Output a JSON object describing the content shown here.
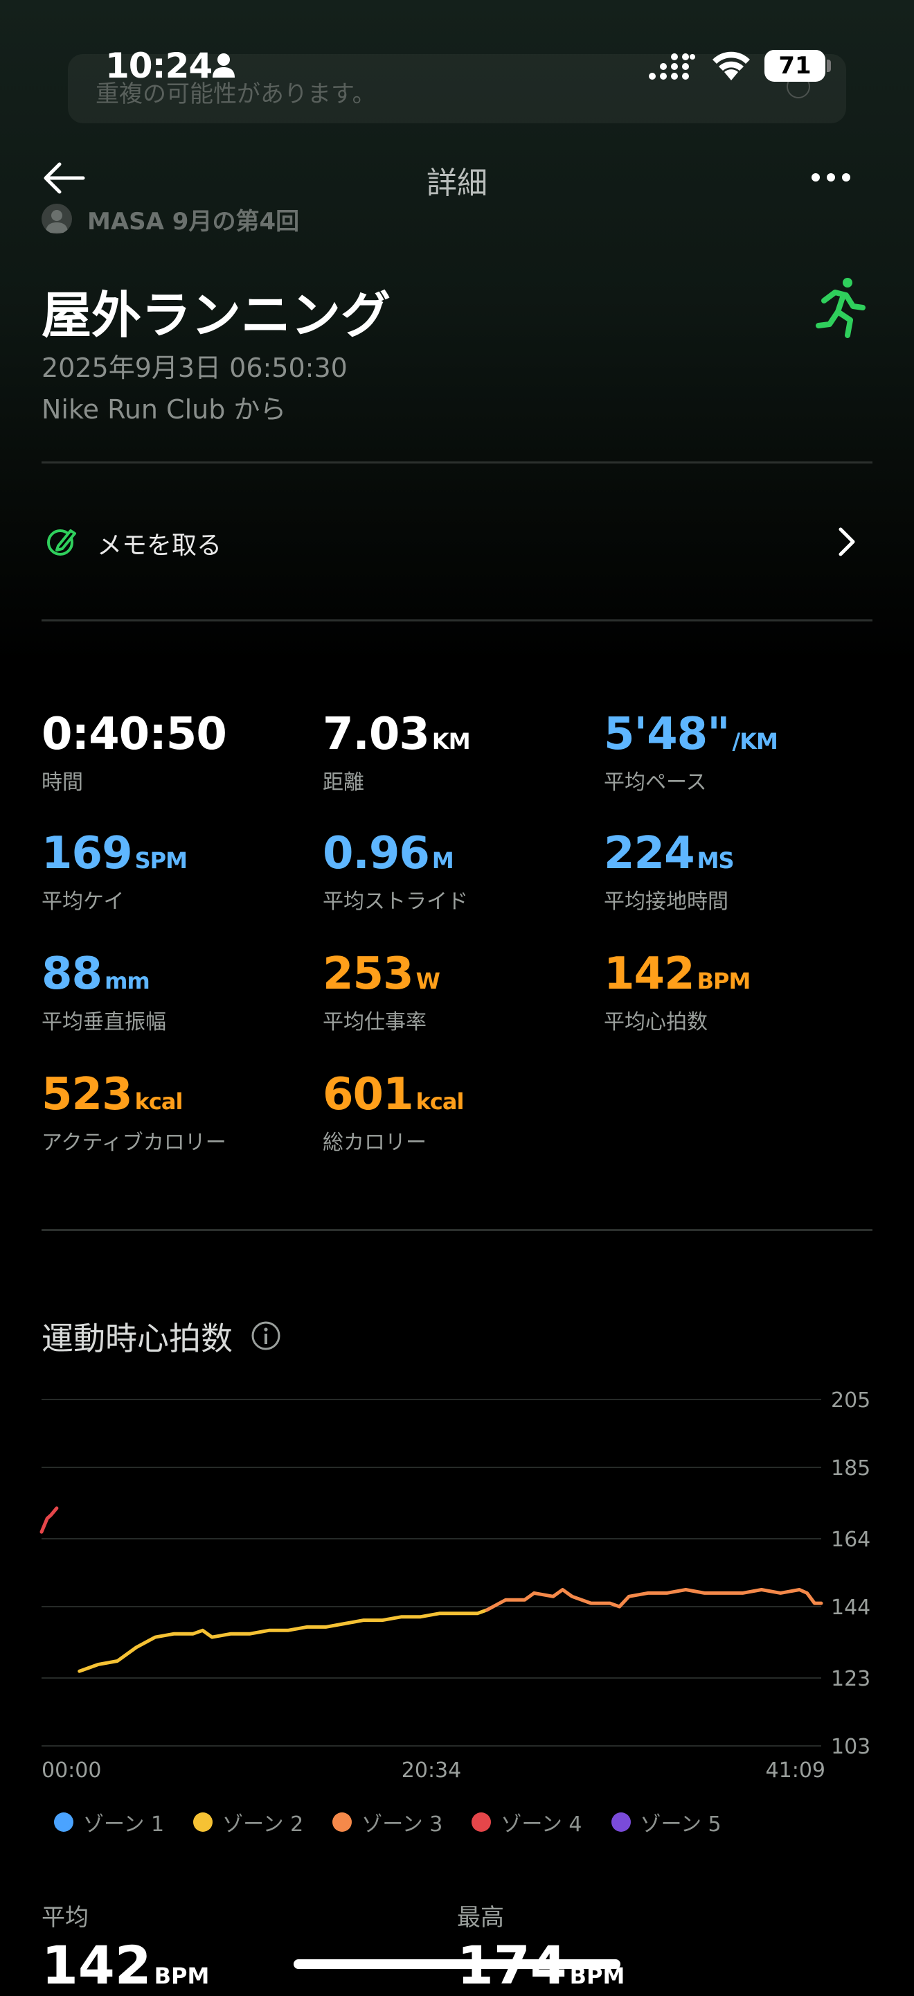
{
  "status_bar": {
    "time": "10:24",
    "battery": "71"
  },
  "notice": {
    "text": "重複の可能性があります。"
  },
  "header": {
    "title": "詳細",
    "user_line": "MASA 9月の第4回"
  },
  "activity": {
    "title": "屋外ランニング",
    "date": "2025年9月3日 06:50:30",
    "source": "Nike Run Club から",
    "icon": "running-icon",
    "accent_color": "#2fcf5c"
  },
  "memo": {
    "label": "メモを取る"
  },
  "metrics": [
    {
      "value": "0:40:50",
      "unit": "",
      "label": "時間",
      "color": "#ffffff"
    },
    {
      "value": "7.03",
      "unit": "KM",
      "label": "距離",
      "color": "#ffffff"
    },
    {
      "value": "5'48\"",
      "unit": "/KM",
      "label": "平均ペース",
      "color": "#5eb6ff"
    },
    {
      "value": "169",
      "unit": "SPM",
      "label": "平均ケイ",
      "color": "#5eb6ff"
    },
    {
      "value": "0.96",
      "unit": "M",
      "label": "平均ストライド",
      "color": "#5eb6ff"
    },
    {
      "value": "224",
      "unit": "MS",
      "label": "平均接地時間",
      "color": "#5eb6ff"
    },
    {
      "value": "88",
      "unit": "mm",
      "label": "平均垂直振幅",
      "color": "#5eb6ff"
    },
    {
      "value": "253",
      "unit": "W",
      "label": "平均仕事率",
      "color": "#ff9f1a"
    },
    {
      "value": "142",
      "unit": "BPM",
      "label": "平均心拍数",
      "color": "#ff9f1a"
    },
    {
      "value": "523",
      "unit": "kcal",
      "label": "アクティブカロリー",
      "color": "#ff9f1a"
    },
    {
      "value": "601",
      "unit": "kcal",
      "label": "総カロリー",
      "color": "#ff9f1a"
    }
  ],
  "heart_rate_section": {
    "title": "運動時心拍数",
    "summary": [
      {
        "label": "平均",
        "value": "142",
        "unit": "BPM"
      },
      {
        "label": "最高",
        "value": "174",
        "unit": "BPM"
      }
    ]
  },
  "chart_data": {
    "type": "line",
    "title": "運動時心拍数",
    "x_tick_labels": [
      "00:00",
      "20:34",
      "41:09"
    ],
    "y_tick_labels": [
      "205",
      "185",
      "164",
      "144",
      "123",
      "103"
    ],
    "ylim": [
      103,
      205
    ],
    "xlim_minutes": [
      0,
      41.15
    ],
    "grid": true,
    "legend_position": "bottom",
    "legend": [
      {
        "name": "ゾーン 1",
        "color": "#4aa3ff"
      },
      {
        "name": "ゾーン 2",
        "color": "#f6c234"
      },
      {
        "name": "ゾーン 3",
        "color": "#f5894a"
      },
      {
        "name": "ゾーン 4",
        "color": "#e5464a"
      },
      {
        "name": "ゾーン 5",
        "color": "#7a4bd9"
      }
    ],
    "series": [
      {
        "name": "ゾーン 4",
        "color": "#e5464a",
        "x": [
          0.0,
          0.3,
          0.5,
          0.8
        ],
        "y": [
          166,
          170,
          171,
          173
        ]
      },
      {
        "name": "ゾーン 2",
        "color": "#f6c234",
        "x": [
          2.0,
          3.0,
          4.0,
          5.0,
          6.0,
          7.0,
          8.0,
          8.5,
          9.0,
          10.0,
          11.0,
          12.0,
          13.0,
          14.0,
          15.0,
          16.0,
          17.0,
          18.0,
          19.0,
          20.0,
          21.0,
          22.0,
          23.0,
          23.5
        ],
        "y": [
          125,
          127,
          128,
          132,
          135,
          136,
          136,
          137,
          135,
          136,
          136,
          137,
          137,
          138,
          138,
          139,
          140,
          140,
          141,
          141,
          142,
          142,
          142,
          143
        ]
      },
      {
        "name": "ゾーン 3",
        "color": "#f5894a",
        "x": [
          23.5,
          24.5,
          25.5,
          26.0,
          27.0,
          27.5,
          28.0,
          29.0,
          30.0,
          30.5,
          31.0,
          32.0,
          33.0,
          34.0,
          35.0,
          36.0,
          37.0,
          38.0,
          39.0,
          40.0,
          40.4,
          40.8,
          41.15
        ],
        "y": [
          143,
          146,
          146,
          148,
          147,
          149,
          147,
          145,
          145,
          144,
          147,
          148,
          148,
          149,
          148,
          148,
          148,
          149,
          148,
          149,
          148,
          145,
          145
        ]
      }
    ]
  }
}
